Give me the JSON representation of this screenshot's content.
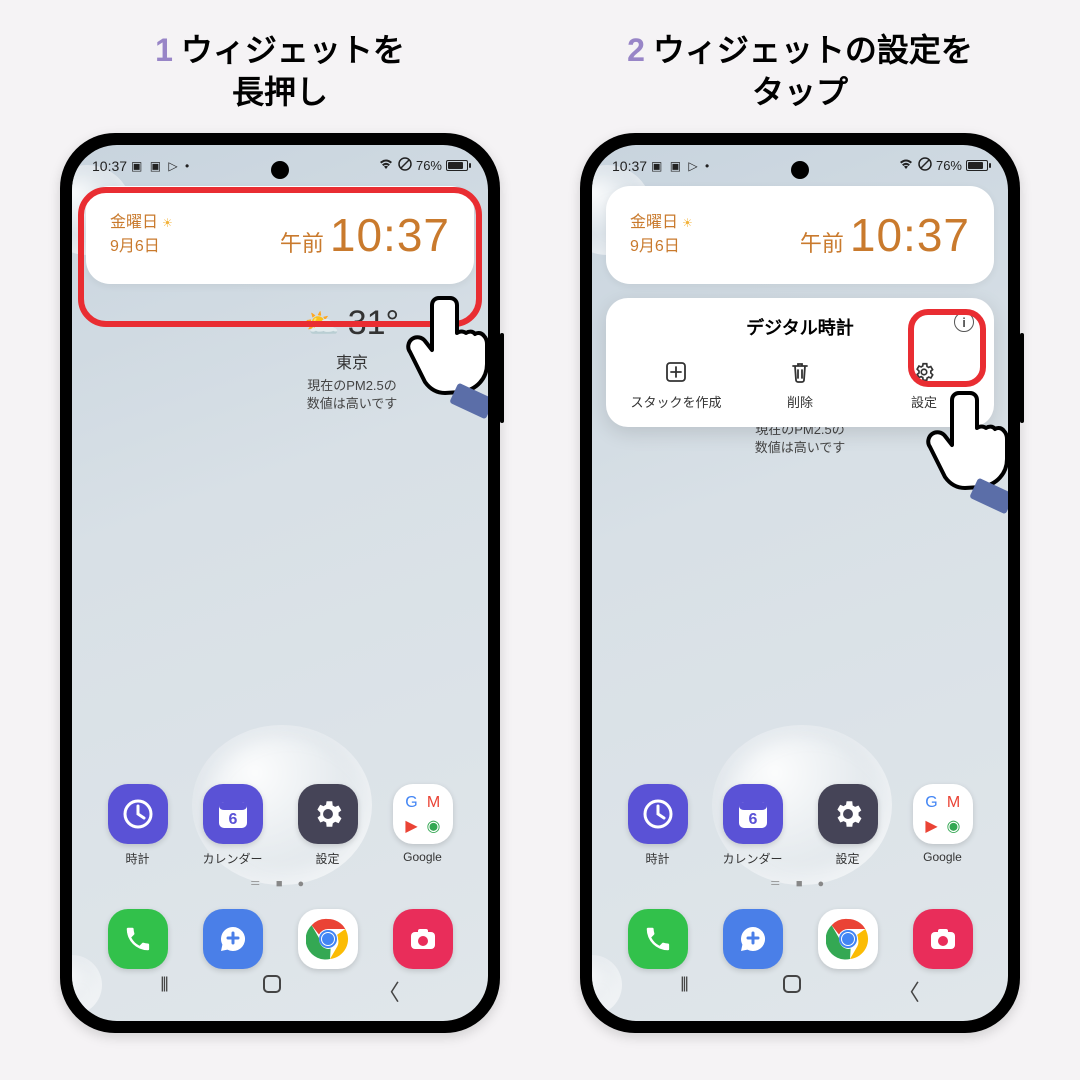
{
  "steps": [
    {
      "num": "1",
      "title_l1": "ウィジェットを",
      "title_l2": "長押し"
    },
    {
      "num": "2",
      "title_l1": "ウィジェットの設定を",
      "title_l2": "タップ"
    }
  ],
  "statusbar": {
    "time": "10:37",
    "battery_text": "76%"
  },
  "clock_widget": {
    "day": "金曜日",
    "date": "9月6日",
    "ampm": "午前",
    "time": "10:37"
  },
  "weather": {
    "temp": "31°",
    "city": "東京",
    "desc_l1": "現在のPM2.5の",
    "desc_l2": "数値は高いです"
  },
  "popup": {
    "title": "デジタル時計",
    "items": [
      {
        "label": "スタックを作成"
      },
      {
        "label": "削除"
      },
      {
        "label": "設定"
      }
    ]
  },
  "apps_row1": [
    {
      "label": "時計"
    },
    {
      "label": "カレンダー",
      "cal_num": "6"
    },
    {
      "label": "設定"
    },
    {
      "label": "Google"
    }
  ],
  "page_indicator": "＝ ■ ●",
  "colors": {
    "highlight": "#e92d32",
    "step_num": "#9885c7",
    "clock_text": "#c97a2d"
  }
}
